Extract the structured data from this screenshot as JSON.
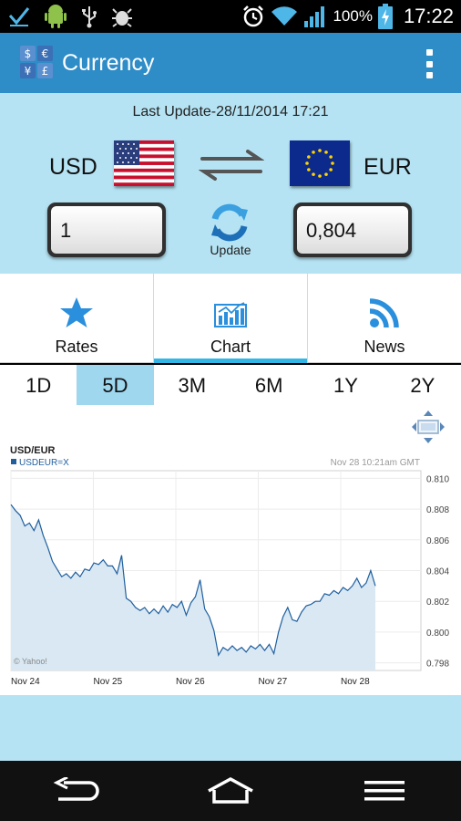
{
  "status_bar": {
    "battery_percent": "100%",
    "time": "17:22",
    "icons": [
      "download-check-icon",
      "android-icon",
      "usb-icon",
      "debug-bug-icon",
      "alarm-icon",
      "wifi-icon",
      "signal-icon",
      "battery-charging-icon"
    ]
  },
  "app": {
    "title": "Currency",
    "icon": "currency-exchange-icon"
  },
  "converter": {
    "last_update": "Last Update-28/11/2014 17:21",
    "from_currency": "USD",
    "to_currency": "EUR",
    "from_amount": "1",
    "to_amount": "0,804",
    "update_label": "Update"
  },
  "tabs": [
    {
      "label": "Rates",
      "icon": "star-icon",
      "active": false
    },
    {
      "label": "Chart",
      "icon": "bar-chart-icon",
      "active": true
    },
    {
      "label": "News",
      "icon": "rss-icon",
      "active": false
    }
  ],
  "periods": [
    "1D",
    "5D",
    "3M",
    "6M",
    "1Y",
    "2Y"
  ],
  "selected_period": "5D",
  "colors": {
    "accent": "#2e8cc7",
    "panel": "#b5e3f3",
    "tab_indicator": "#33b5e5",
    "chart_line": "#1f5f9e",
    "chart_fill": "#d9e8f3"
  },
  "chart_data": {
    "type": "area",
    "title": "USD/EUR",
    "legend": "USDEUR=X",
    "timestamp": "Nov 28 10:21am GMT",
    "credit": "© Yahoo!",
    "x": [
      "Nov 24",
      "Nov 25",
      "Nov 26",
      "Nov 27",
      "Nov 28"
    ],
    "ylim": [
      0.7975,
      0.8105
    ],
    "y_ticks": [
      "0.810",
      "0.808",
      "0.806",
      "0.804",
      "0.802",
      "0.800",
      "0.798"
    ],
    "grid": true,
    "series": [
      {
        "name": "USDEUR=X",
        "values": [
          0.8083,
          0.8079,
          0.8076,
          0.8069,
          0.8071,
          0.8066,
          0.8073,
          0.8063,
          0.8055,
          0.8046,
          0.8041,
          0.8036,
          0.8038,
          0.8035,
          0.8039,
          0.8036,
          0.8041,
          0.804,
          0.8045,
          0.8044,
          0.8047,
          0.8043,
          0.8043,
          0.8038,
          0.805,
          0.8022,
          0.802,
          0.8016,
          0.8014,
          0.8016,
          0.8012,
          0.8015,
          0.8012,
          0.8017,
          0.8013,
          0.8018,
          0.8016,
          0.802,
          0.8011,
          0.8019,
          0.8023,
          0.8034,
          0.8015,
          0.801,
          0.8001,
          0.7985,
          0.799,
          0.7988,
          0.7991,
          0.7988,
          0.799,
          0.7987,
          0.7991,
          0.7989,
          0.7992,
          0.7988,
          0.7992,
          0.7986,
          0.8,
          0.801,
          0.8016,
          0.8008,
          0.8007,
          0.8013,
          0.8017,
          0.8018,
          0.802,
          0.802,
          0.8025,
          0.8024,
          0.8027,
          0.8025,
          0.8029,
          0.8027,
          0.803,
          0.8035,
          0.8029,
          0.8032,
          0.804,
          0.803
        ]
      }
    ]
  }
}
